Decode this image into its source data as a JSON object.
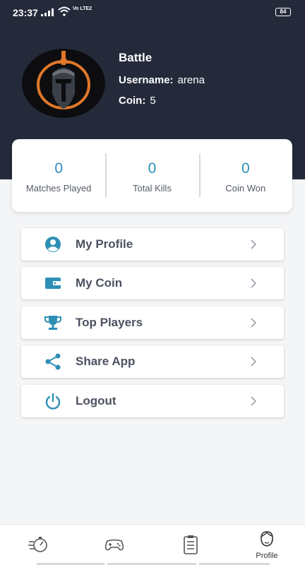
{
  "status_bar": {
    "time": "23:37",
    "network": "Vo LTE2",
    "battery": "84"
  },
  "profile": {
    "name": "Battle",
    "username_label": "Username:",
    "username": "arena",
    "coin_label": "Coin:",
    "coin": "5"
  },
  "stats": [
    {
      "value": "0",
      "label": "Matches Played"
    },
    {
      "value": "0",
      "label": "Total Kills"
    },
    {
      "value": "0",
      "label": "Coin Won"
    }
  ],
  "menu": [
    {
      "label": "My Profile",
      "icon": "user-circle-icon"
    },
    {
      "label": "My Coin",
      "icon": "wallet-icon"
    },
    {
      "label": "Top Players",
      "icon": "trophy-icon"
    },
    {
      "label": "Share App",
      "icon": "share-icon"
    },
    {
      "label": "Logout",
      "icon": "power-icon"
    }
  ],
  "bottom_nav": {
    "active": "Profile",
    "profile_label": "Profile"
  },
  "colors": {
    "header": "#252a3b",
    "accent": "#2e8fb5",
    "menu_text": "#4b5160",
    "background": "#f4f5f7"
  }
}
